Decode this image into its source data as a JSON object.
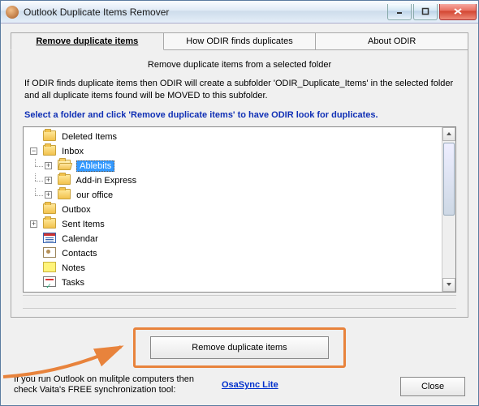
{
  "window": {
    "title": "Outlook Duplicate Items Remover"
  },
  "tabs": {
    "remove": "Remove duplicate items",
    "how": "How ODIR finds duplicates",
    "about": "About ODIR"
  },
  "intro": "Remove duplicate items from a selected folder",
  "description": "If ODIR finds duplicate items then ODIR will create a subfolder 'ODIR_Duplicate_Items' in the selected folder and all duplicate items found will be MOVED to this subfolder.",
  "instruction": "Select a folder and click 'Remove duplicate items' to have ODIR look for duplicates.",
  "tree": {
    "deleted": "Deleted Items",
    "inbox": "Inbox",
    "ablebits": "Ablebits",
    "addin": "Add-in Express",
    "office": "our office",
    "outbox": "Outbox",
    "sent": "Sent Items",
    "calendar": "Calendar",
    "contacts": "Contacts",
    "notes": "Notes",
    "tasks": "Tasks"
  },
  "action_button": "Remove duplicate items",
  "footer": {
    "text": "If you run Outlook on mulitple computers then check Vaita's FREE synchronization tool:",
    "link": "OsaSync Lite",
    "close": "Close"
  }
}
